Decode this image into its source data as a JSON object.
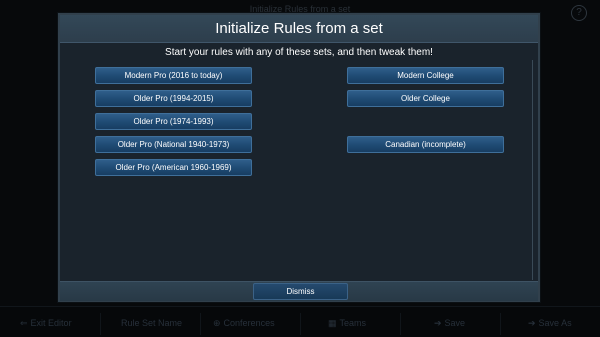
{
  "background": {
    "title": "Initialize Rules from a set",
    "help_glyph": "?",
    "bottom_bar": [
      {
        "icon": "exit-icon",
        "glyph": "⇐",
        "label": "Exit Editor"
      },
      {
        "icon": "rules-icon",
        "glyph": "",
        "label": "Rule Set Name"
      },
      {
        "icon": "conference-icon",
        "glyph": "⊕",
        "label": "Conferences"
      },
      {
        "icon": "teams-icon",
        "glyph": "▦",
        "label": "Teams"
      },
      {
        "icon": "save-icon",
        "glyph": "➔",
        "label": "Save"
      },
      {
        "icon": "save-as-icon",
        "glyph": "➔",
        "label": "Save As"
      }
    ]
  },
  "dialog": {
    "title": "Initialize Rules from a set",
    "subtitle": "Start your rules with any of these sets, and then tweak them!",
    "left_buttons": [
      "Modern Pro (2016 to today)",
      "Older Pro (1994-2015)",
      "Older Pro (1974-1993)",
      "Older Pro (National 1940-1973)",
      "Older Pro (American 1960-1969)"
    ],
    "right_buttons": [
      "Modern College",
      "Older College",
      "Canadian (incomplete)"
    ],
    "dismiss_label": "Dismiss"
  },
  "colors": {
    "button_blue": "#1f4a73",
    "header": "#334858",
    "panel": "#1a232c"
  }
}
